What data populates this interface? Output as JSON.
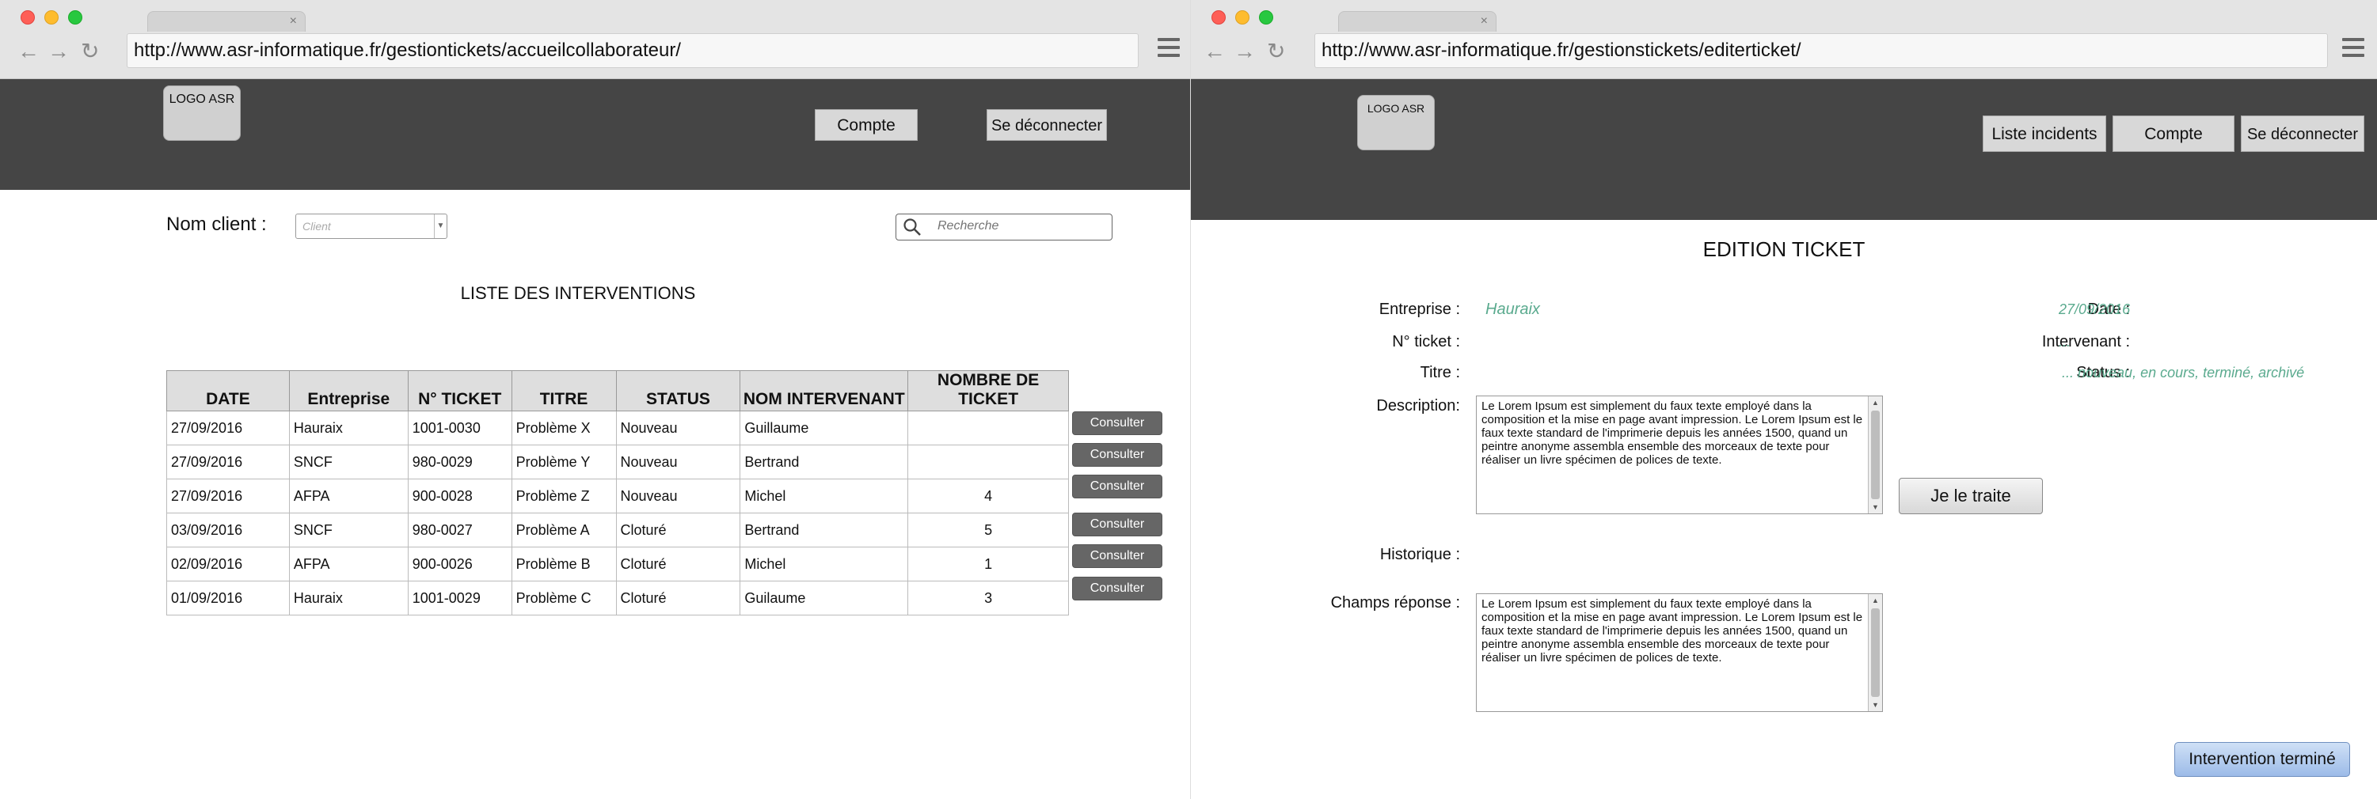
{
  "left": {
    "url": "http://www.asr-informatique.fr/gestiontickets/accueilcollaborateur/",
    "logo": "LOGO ASR",
    "compte": "Compte",
    "deconnecter": "Se déconnecter",
    "client_label": "Nom client :",
    "client_select": "Client",
    "search_placeholder": "Recherche",
    "list_title": "LISTE DES INTERVENTIONS",
    "columns": [
      "DATE",
      "Entreprise",
      "N° TICKET",
      "TITRE",
      "STATUS",
      "NOM INTERVENANT",
      "NOMBRE DE TICKET"
    ],
    "rows": [
      [
        "27/09/2016",
        "Hauraix",
        "1001-0030",
        "Problème X",
        "Nouveau",
        "Guillaume",
        ""
      ],
      [
        "27/09/2016",
        "SNCF",
        "980-0029",
        "Problème Y",
        "Nouveau",
        "Bertrand",
        ""
      ],
      [
        "27/09/2016",
        "AFPA",
        "900-0028",
        "Problème Z",
        "Nouveau",
        "Michel",
        "4"
      ],
      [
        "03/09/2016",
        "SNCF",
        "980-0027",
        "Problème A",
        "Cloturé",
        "Bertrand",
        "5"
      ],
      [
        "02/09/2016",
        "AFPA",
        "900-0026",
        "Problème B",
        "Cloturé",
        "Michel",
        "1"
      ],
      [
        "01/09/2016",
        "Hauraix",
        "1001-0029",
        "Problème C",
        "Cloturé",
        "Guilaume",
        "3"
      ]
    ],
    "consult_label": "Consulter"
  },
  "right": {
    "url": "http://www.asr-informatique.fr/gestionstickets/editerticket/",
    "logo": "LOGO ASR",
    "liste_incidents": "Liste incidents",
    "compte": "Compte",
    "deconnecter": "Se déconnecter",
    "title": "EDITION TICKET",
    "entreprise_label": "Entreprise :",
    "entreprise_value": "Hauraix",
    "ticket_label": "N° ticket :",
    "titre_label": "Titre :",
    "description_label": "Description:",
    "date_label": "Date :",
    "date_value": "27/09/2016",
    "intervenant_label": "Intervenant :",
    "intervenant_value": "...",
    "status_label": "Status :",
    "status_value": "... nouveau, en cours, terminé, archivé",
    "description_text": "Le Lorem Ipsum est simplement du faux texte employé dans la composition et la mise en page avant impression. Le Lorem Ipsum est le faux texte standard de l'imprimerie depuis les années 1500, quand un peintre anonyme assembla ensemble des morceaux de texte pour réaliser un livre spécimen de polices de texte.",
    "je_le_traite": "Je le traite",
    "historique_label": "Historique :",
    "reponse_label": "Champs réponse :",
    "reponse_text": "Le Lorem Ipsum est simplement du faux texte employé dans la composition et la mise en page avant impression. Le Lorem Ipsum est le faux texte standard de l'imprimerie depuis les années 1500, quand un peintre anonyme assembla ensemble des morceaux de texte pour réaliser un livre spécimen de polices de texte.",
    "intervention_termine": "Intervention terminé"
  }
}
